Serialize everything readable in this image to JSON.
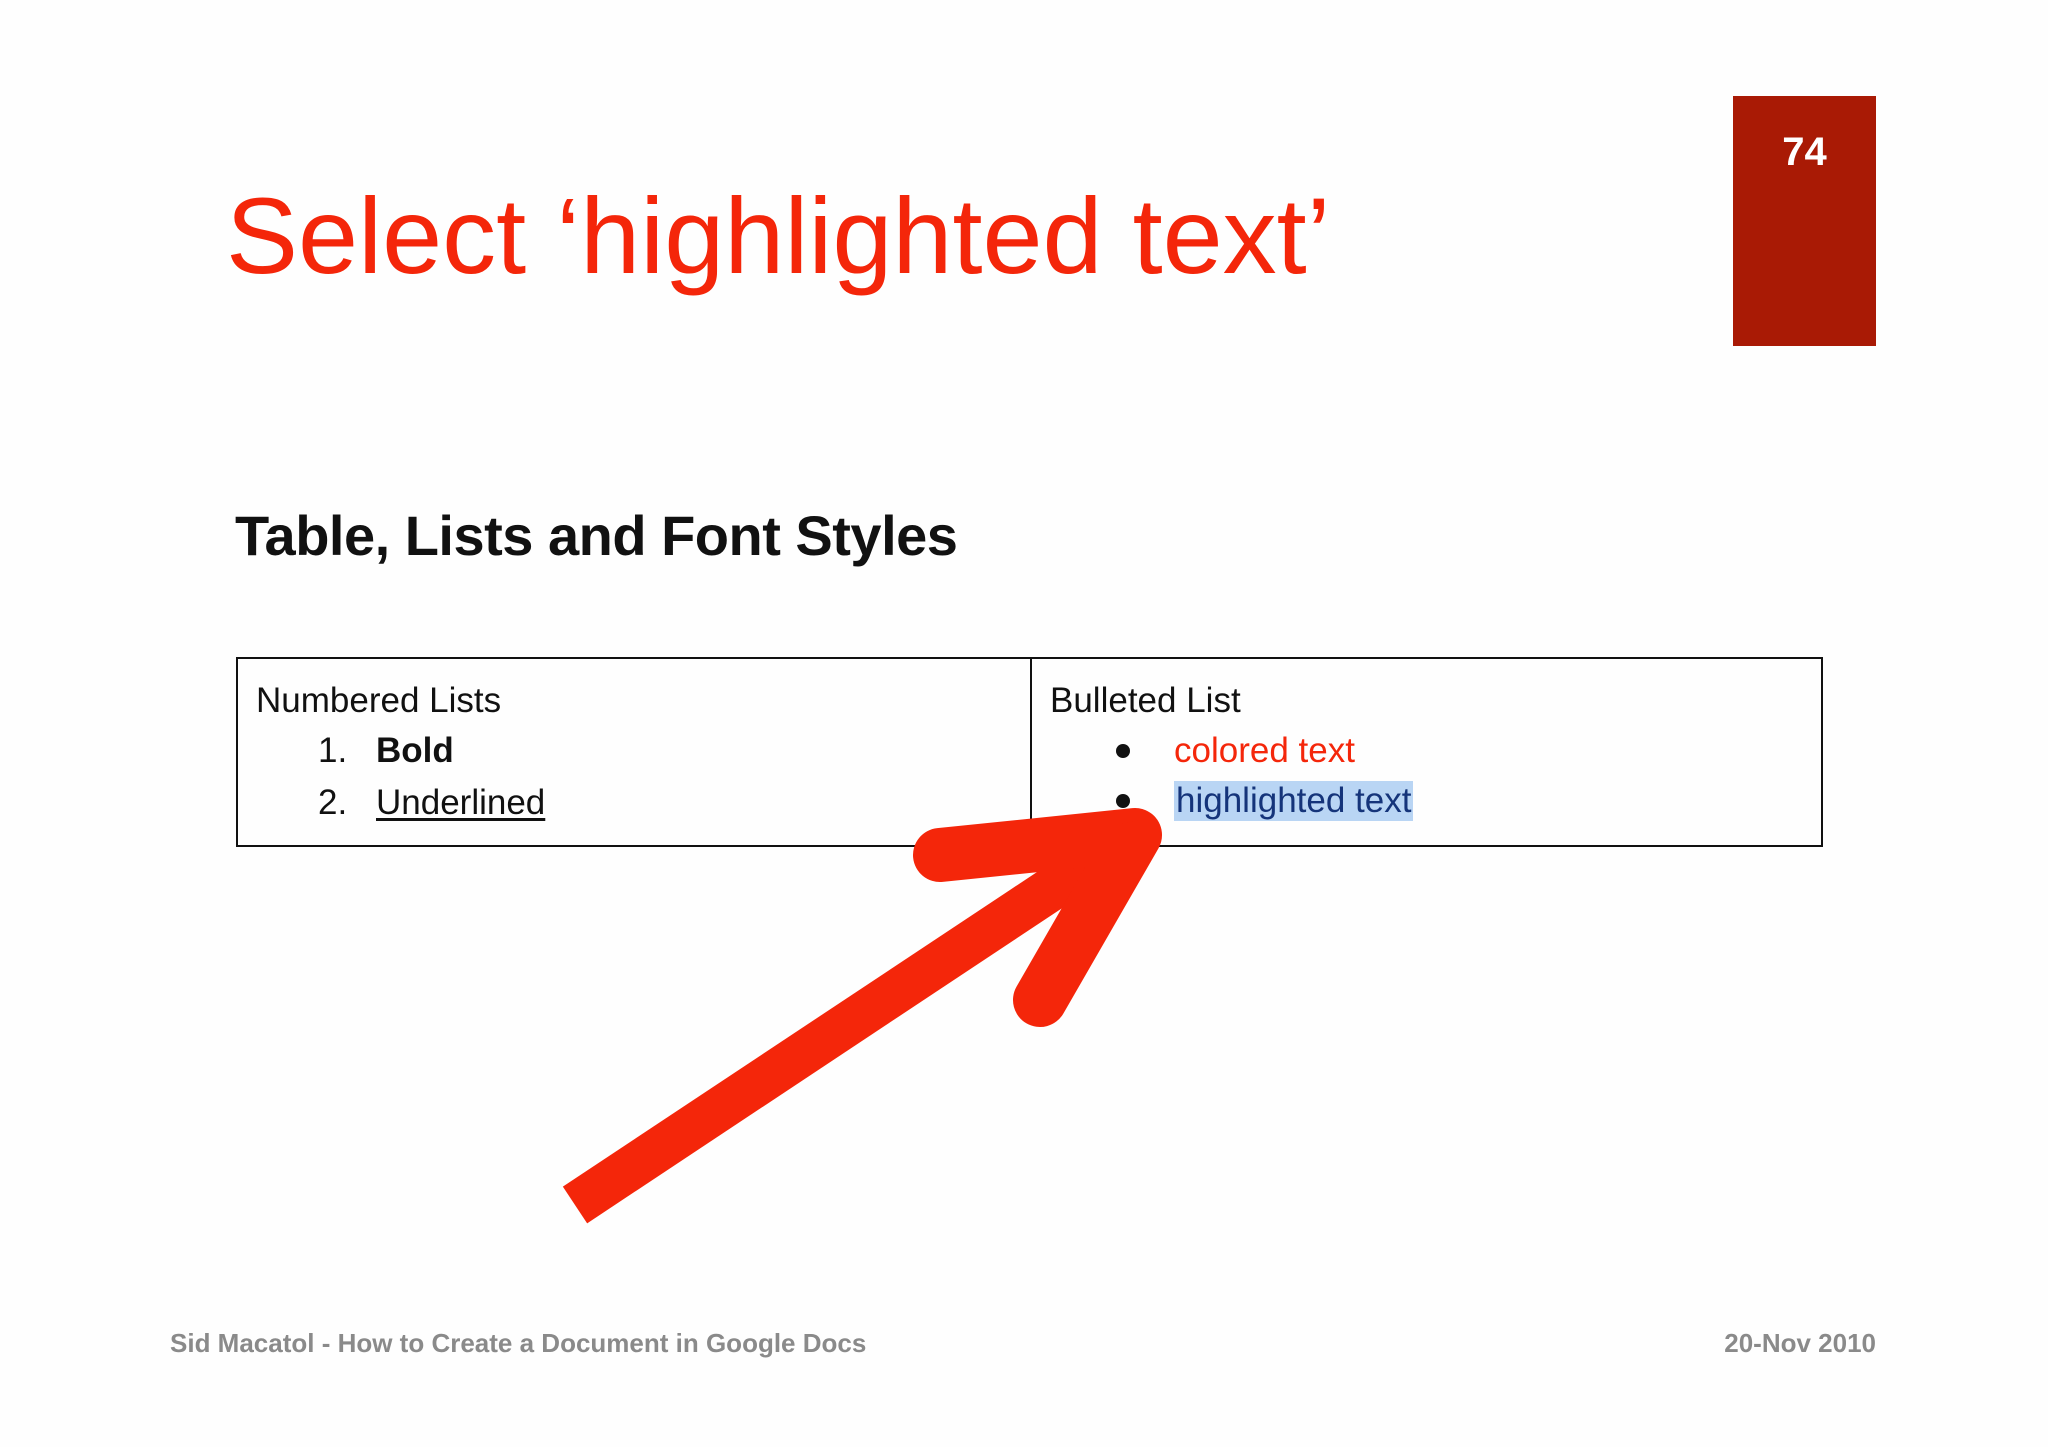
{
  "slide": {
    "title": "Select ‘highlighted text’",
    "page_number": "74"
  },
  "document": {
    "heading": "Table, Lists and Font Styles",
    "table": {
      "left": {
        "heading": "Numbered Lists",
        "items": [
          {
            "marker": "1.",
            "text": "Bold",
            "style": "bold"
          },
          {
            "marker": "2.",
            "text": "Underlined",
            "style": "underline"
          }
        ]
      },
      "right": {
        "heading": "Bulleted List",
        "items": [
          {
            "text": "colored text",
            "style": "colored"
          },
          {
            "text": "highlighted text",
            "style": "highlighted"
          }
        ]
      }
    }
  },
  "annotation": {
    "arrow_color": "#f4260a",
    "icon": "arrow-pointer-icon"
  },
  "footer": {
    "left": "Sid Macatol - How to Create a Document in Google Docs",
    "right": "20-Nov 2010"
  },
  "colors": {
    "title": "#f4260a",
    "page_box": "#a91a05",
    "highlight": "#b9d5f4",
    "footer": "#8a8a8a"
  }
}
